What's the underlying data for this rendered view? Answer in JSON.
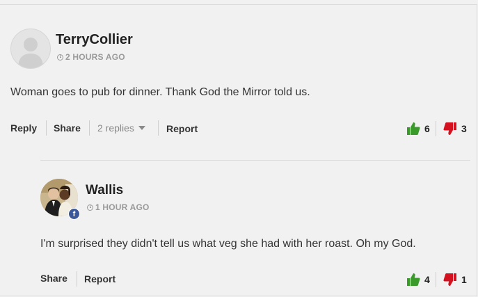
{
  "comment": {
    "author": "TerryCollier",
    "time": "2 HOURS AGO",
    "text": "Woman goes to pub for dinner. Thank God the Mirror told us.",
    "actions": {
      "reply": "Reply",
      "share": "Share",
      "replies": "2 replies",
      "report": "Report"
    },
    "upvotes": "6",
    "downvotes": "3"
  },
  "reply": {
    "author": "Wallis",
    "time": "1 HOUR AGO",
    "text": "I'm surprised they didn't tell us what veg she had with her roast. Oh my God.",
    "actions": {
      "share": "Share",
      "report": "Report"
    },
    "upvotes": "4",
    "downvotes": "1",
    "badge": "f"
  },
  "colors": {
    "thumbs_up": "#3a9a2a",
    "thumbs_down": "#d4111e",
    "facebook": "#3b5998"
  },
  "icons": {
    "time": "clock-icon",
    "upvote": "thumbs-up-icon",
    "downvote": "thumbs-down-icon",
    "replies_toggle": "caret-down-icon",
    "social": "facebook-icon"
  }
}
